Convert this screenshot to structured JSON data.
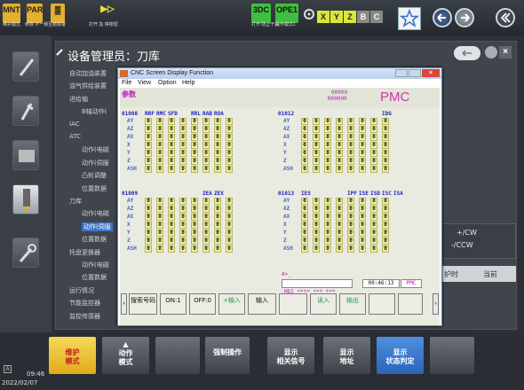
{
  "topbar": {
    "modes": [
      {
        "label": "MNT",
        "sub": "维护模式",
        "color": "#f0b42a"
      },
      {
        "label": "PAR",
        "sub": "参数 不一致",
        "color": "#f0b42a"
      },
      {
        "label": "▓",
        "sub": "互锁报警",
        "color": "#f0b42a"
      }
    ],
    "play_sub": "打开 急 停按钮",
    "play_label": "▶▷",
    "badge_3dc": "3DC",
    "badge_3dc_sub": "打开 防止干扰",
    "badge_ope1": "OPE1",
    "badge_ope1_sub": "操作模式1",
    "xyz": [
      "X",
      "Y",
      "Z",
      "B",
      "C"
    ]
  },
  "page_title": "设备管理员：刀库",
  "tree": [
    {
      "label": "自动加油装置",
      "indent": 0
    },
    {
      "label": "油气供给装置",
      "indent": 0
    },
    {
      "label": "进给轴",
      "indent": 0
    },
    {
      "label": "B轴动作(",
      "indent": 1
    },
    {
      "label": "IAC",
      "indent": 0
    },
    {
      "label": "ATC",
      "indent": 0
    },
    {
      "label": "动作(电磁",
      "indent": 1
    },
    {
      "label": "动作(伺服",
      "indent": 1
    },
    {
      "label": "凸轮调整",
      "indent": 1
    },
    {
      "label": "位置数据",
      "indent": 1
    },
    {
      "label": "刀库",
      "indent": 0
    },
    {
      "label": "动作(电磁",
      "indent": 1
    },
    {
      "label": "动作(伺服",
      "indent": 1,
      "selected": true
    },
    {
      "label": "位置数据",
      "indent": 1
    },
    {
      "label": "托盘更换器",
      "indent": 0
    },
    {
      "label": "动作(电磁",
      "indent": 1
    },
    {
      "label": "位置数据",
      "indent": 1
    },
    {
      "label": "运行情况",
      "indent": 0
    },
    {
      "label": "节能监控器",
      "indent": 0
    },
    {
      "label": "监控传感器",
      "indent": 0
    }
  ],
  "dialog": {
    "title": "CNC Screen Display Function",
    "menu": [
      "File",
      "View",
      "Option",
      "Help"
    ],
    "param_label": "参数",
    "prog_top": "00000",
    "prog_bot": "N00000",
    "pmc": "PMC",
    "left_block1": {
      "addr": "01008",
      "bits": [
        "RRF",
        "RMC",
        "SFD",
        "",
        "RRL",
        "RAB",
        "ROA"
      ],
      "rows": [
        "AY",
        "AZ",
        "AX",
        "X",
        "Y",
        "Z",
        "ASH"
      ]
    },
    "right_block1": {
      "addr": "01012",
      "bits": [
        "",
        "",
        "",
        "",
        "",
        "",
        "",
        "IDG"
      ],
      "rows": [
        "AY",
        "AZ",
        "AX",
        "X",
        "Y",
        "Z",
        "ASH"
      ]
    },
    "left_block2": {
      "addr": "01009",
      "bits": [
        "",
        "",
        "",
        "",
        "",
        "ZEA",
        "ZEX"
      ],
      "rows": [
        "AY",
        "AZ",
        "AX",
        "X",
        "Y",
        "Z",
        "ASH"
      ]
    },
    "right_block2": {
      "addr": "01013",
      "bits": [
        "IES",
        "",
        "",
        "",
        "IPF",
        "ISE",
        "ISD",
        "ISC",
        "ISA"
      ],
      "rows": [
        "AY",
        "AZ",
        "AX",
        "X",
        "Y",
        "Z",
        "ASH"
      ]
    },
    "prompt": "A>_",
    "status_mdi": "MDI **** *** ***",
    "status_time": "09:46:13",
    "status_pmc": "PMC",
    "softkeys": [
      "搜索号码",
      "ON:1",
      "OFF:0",
      "+输入",
      "输入",
      "",
      "读入",
      "输出",
      "",
      ""
    ]
  },
  "right_panel": {
    "cw": "+/CW",
    "ccw": "-/CCW",
    "col1": "护时",
    "col2": "当前"
  },
  "bottom": {
    "buttons": [
      {
        "label": "维护\n模式",
        "active": true
      },
      {
        "label": "动作\n模式",
        "arrow": "▲"
      },
      {
        "label": ""
      },
      {
        "label": "强制操作"
      },
      {
        "label": "显示\n相关信号"
      },
      {
        "label": "显示\n地址"
      },
      {
        "label": "显示\n状态判定",
        "blue": true
      },
      {
        "label": ""
      }
    ],
    "time": "09:46",
    "date": "2022/02/07",
    "corner": "A"
  }
}
